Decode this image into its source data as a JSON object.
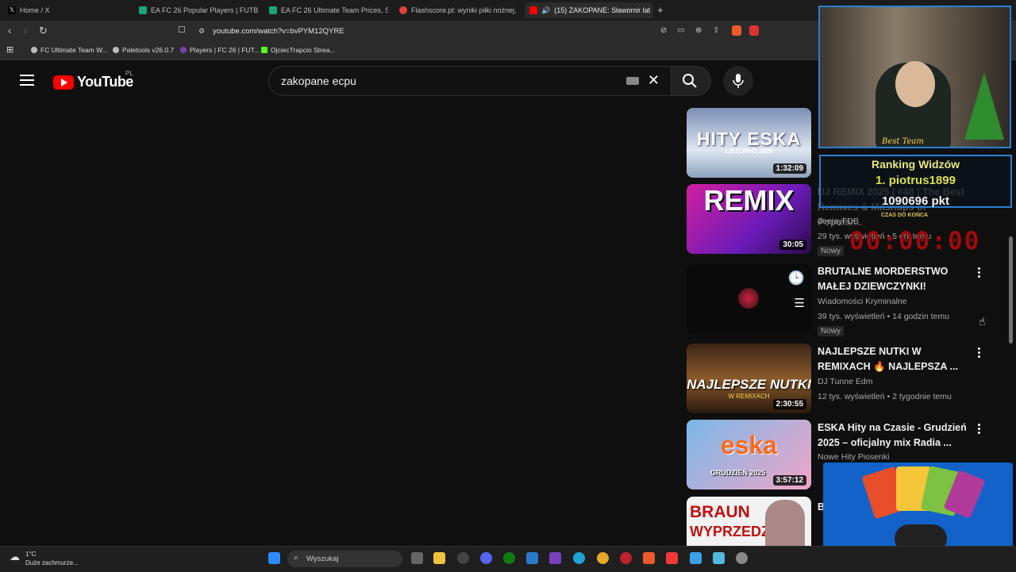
{
  "browser": {
    "tabs": [
      {
        "label": "Home / X",
        "fav": "#000000"
      },
      {
        "label": "EA FC 26 Popular Players | FUTBIN",
        "fav": "#1ca37a"
      },
      {
        "label": "EA FC 26 Ultimate Team Prices, Squa",
        "fav": "#1ca37a"
      },
      {
        "label": "Flashscore.pl: wyniki piłki nożnej, wy",
        "fav": "#e2403f"
      },
      {
        "label": "(15) ZAKOPANE: Sławomir lat",
        "fav": "#ff0000"
      }
    ],
    "url": "youtube.com/watch?v=bvPYM12QYRE",
    "bookmarks": [
      {
        "label": "FC Ultimate Team W...",
        "fav": "#bbbbbb"
      },
      {
        "label": "Paletools v26.0.7",
        "fav": "#bbbbbb"
      },
      {
        "label": "Players | FC 26 | FUT...",
        "fav": "#7b3fb3"
      },
      {
        "label": "OjciecTrapcio Strea...",
        "fav": "#53fc18"
      }
    ]
  },
  "youtube": {
    "logo_text": "YouTube",
    "country_code": "PL",
    "search_query": "zakopane ecpu"
  },
  "videos": [
    {
      "thumb_text": "HITY ESKA",
      "thumb_sub": "LISTOPAD 2025",
      "duration": "1:32:09"
    },
    {
      "thumb_text": "REMIX",
      "duration": "30:05",
      "title": "DJ REMIX 2025 | #48 | The Best Remixes & Mashups of Popular...",
      "channel": "deejayFDB",
      "meta": "29 tys. wyświetleń • 5 dni temu",
      "badge": "Nowy"
    },
    {
      "thumb_text": "",
      "duration": "",
      "title": "BRUTALNE MORDERSTWO MAŁEJ DZIEWCZYNKI!",
      "channel": "Wiadomości Kryminalne",
      "meta": "39 tys. wyświetleń • 14 godzin temu",
      "badge": "Nowy"
    },
    {
      "thumb_text": "NAJLEPSZE NUTKI",
      "thumb_sub": "W REMIXACH",
      "duration": "2:30:55",
      "title": "NAJLEPSZE NUTKI W REMIXACH 🔥 NAJLEPSZA ...",
      "channel": "DJ Tunne Edm",
      "meta": "12 tys. wyświetleń • 2 tygodnie temu"
    },
    {
      "thumb_text": "eska",
      "thumb_sub": "GRUDZIEŃ 2025",
      "duration": "3:57:12",
      "title": "ESKA Hity na Czasie - Grudzień 2025 – oficjalny mix Radia ...",
      "channel": "Nowe Hity Piosenki"
    },
    {
      "thumb_text": "BRAUN",
      "thumb_sub": "WYPRZEDZA",
      "title": "B"
    }
  ],
  "overlay": {
    "ranking_title": "Ranking Widzów",
    "ranking_line": "1. piotrus1899",
    "ranking_points": "1090696 pkt",
    "countdown_label": "CZAS DO KOŃCA",
    "timer": "00:00:00",
    "webcam_label": "Best Team"
  },
  "taskbar": {
    "weather_temp": "1°C",
    "weather_desc": "Duże zachmurze...",
    "search_label": "Wyszukaj"
  }
}
